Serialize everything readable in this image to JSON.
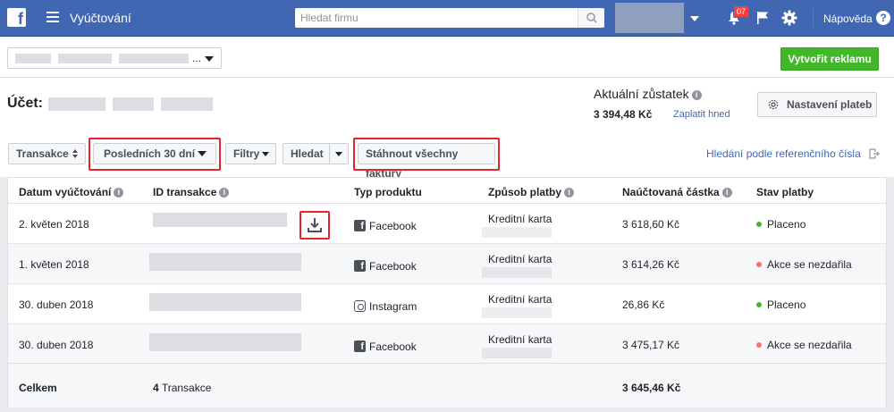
{
  "topbar": {
    "title": "Vyúčtování",
    "search_placeholder": "Hledat firmu",
    "notification_count": "07",
    "help": "Nápověda",
    "help_glyph": "?"
  },
  "subbar": {
    "account_ellipsis": "...",
    "create_button": "Vytvořit reklamu"
  },
  "account": {
    "label": "Účet:",
    "balance_label": "Aktuální zůstatek",
    "balance_value": "3 394,48 Kč",
    "pay_now": "Zaplatit hned",
    "settings_button": "Nastavení plateb"
  },
  "filters": {
    "transactions": "Transakce",
    "period": "Posledních 30 dní",
    "filters": "Filtry",
    "search": "Hledat",
    "download_all": "Stáhnout všechny faktury",
    "reference_search": "Hledání podle referenčního čísla"
  },
  "colors": {
    "paid": "#42b72a",
    "failed": "#f3796e",
    "highlight": "#e8222a",
    "brand": "#4267b2"
  },
  "table": {
    "headers": {
      "date": "Datum vyúčtování",
      "id": "ID transakce",
      "product": "Typ produktu",
      "payment": "Způsob platby",
      "amount": "Naúčtovaná částka",
      "status": "Stav platby"
    },
    "rows": [
      {
        "date": "2. květen 2018",
        "product": "Facebook",
        "product_icon": "facebook-icon",
        "payment": "Kreditní karta",
        "amount": "3 618,60 Kč",
        "status": "Placeno",
        "status_type": "paid"
      },
      {
        "date": "1. květen 2018",
        "product": "Facebook",
        "product_icon": "facebook-icon",
        "payment": "Kreditní karta",
        "amount": "3 614,26 Kč",
        "status": "Akce se nezdařila",
        "status_type": "failed"
      },
      {
        "date": "30. duben 2018",
        "product": "Instagram",
        "product_icon": "instagram-icon",
        "payment": "Kreditní karta",
        "amount": "26,86 Kč",
        "status": "Placeno",
        "status_type": "paid"
      },
      {
        "date": "30. duben 2018",
        "product": "Facebook",
        "product_icon": "facebook-icon",
        "payment": "Kreditní karta",
        "amount": "3 475,17 Kč",
        "status": "Akce se nezdařila",
        "status_type": "failed"
      }
    ],
    "footer": {
      "label": "Celkem",
      "count": "4",
      "count_label": "Transakce",
      "total": "3 645,46 Kč"
    }
  }
}
